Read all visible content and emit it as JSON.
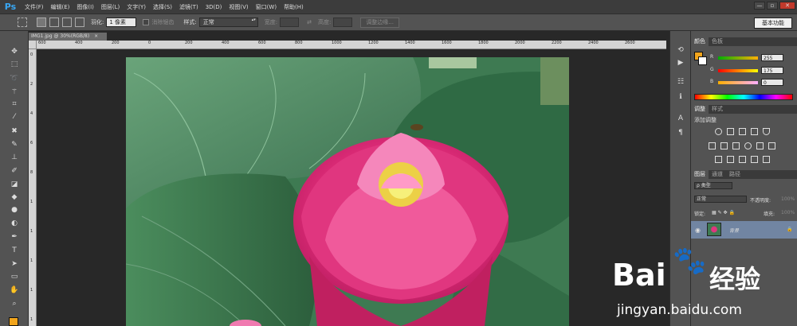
{
  "app": {
    "logo": "Ps"
  },
  "menu": [
    "文件(F)",
    "编辑(E)",
    "图像(I)",
    "图层(L)",
    "文字(Y)",
    "选择(S)",
    "滤镜(T)",
    "3D(D)",
    "视图(V)",
    "窗口(W)",
    "帮助(H)"
  ],
  "window_controls": [
    "—",
    "▫",
    "✕"
  ],
  "options": {
    "feather_label": "羽化:",
    "feather_value": "1 像素",
    "antialias_label": "消除锯齿",
    "style_label": "样式:",
    "style_value": "正常",
    "width_label": "宽度:",
    "height_label": "高度:",
    "refine_edge": "调整边缘...",
    "workspace": "基本功能"
  },
  "document": {
    "tab_title": "IMG1.jpg @ 30%(RGB/8)",
    "tab_close": "×"
  },
  "ruler": {
    "top_labels": [
      "600",
      "400",
      "200",
      "0",
      "200",
      "400",
      "600",
      "800",
      "1000",
      "1200",
      "1400",
      "1600",
      "1800",
      "2000",
      "2200",
      "2400",
      "2600"
    ],
    "left_labels": [
      "0",
      "2",
      "4",
      "6",
      "8",
      "1",
      "1",
      "1",
      "1",
      "1"
    ]
  },
  "panels": {
    "color": {
      "tabs": [
        "颜色",
        "色板"
      ],
      "r_label": "R",
      "r_value": "255",
      "g_label": "G",
      "g_value": "175",
      "b_label": "B",
      "b_value": "0",
      "foreground": "#f2a51c"
    },
    "adjustments": {
      "tabs": [
        "调整",
        "样式"
      ],
      "title": "添加调整"
    },
    "layers": {
      "tabs": [
        "图层",
        "通道",
        "路径"
      ],
      "filter_label": "ρ 类型",
      "blend_mode": "正常",
      "opacity_label": "不透明度:",
      "opacity_value": "100%",
      "lock_label": "锁定:",
      "fill_label": "填充:",
      "fill_value": "100%",
      "layer_name": "背景"
    }
  },
  "watermark": {
    "brand": "Bai",
    "brand_suffix": "经验",
    "url": "jingyan.baidu.com"
  }
}
